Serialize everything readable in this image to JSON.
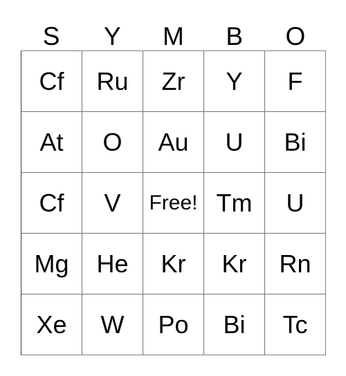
{
  "card": {
    "title_letters": [
      "S",
      "Y",
      "M",
      "B",
      "O"
    ],
    "free_label": "Free!",
    "colors": {
      "background": "#ffffff",
      "text": "#000000",
      "grid_line": "#737373",
      "outer_line": "#808080"
    },
    "grid": {
      "rows": 5,
      "columns": 5,
      "cells": [
        [
          {
            "label": "Cf"
          },
          {
            "label": "Ru"
          },
          {
            "label": "Zr"
          },
          {
            "label": "Y"
          },
          {
            "label": "F"
          }
        ],
        [
          {
            "label": "At"
          },
          {
            "label": "O"
          },
          {
            "label": "Au"
          },
          {
            "label": "U"
          },
          {
            "label": "Bi"
          }
        ],
        [
          {
            "label": "Cf"
          },
          {
            "label": "V"
          },
          {
            "label": "Free!"
          },
          {
            "label": "Tm"
          },
          {
            "label": "U"
          }
        ],
        [
          {
            "label": "Mg"
          },
          {
            "label": "He"
          },
          {
            "label": "Kr"
          },
          {
            "label": "Kr"
          },
          {
            "label": "Rn"
          }
        ],
        [
          {
            "label": "Xe"
          },
          {
            "label": "W"
          },
          {
            "label": "Po"
          },
          {
            "label": "Bi"
          },
          {
            "label": "Tc"
          }
        ]
      ]
    }
  }
}
